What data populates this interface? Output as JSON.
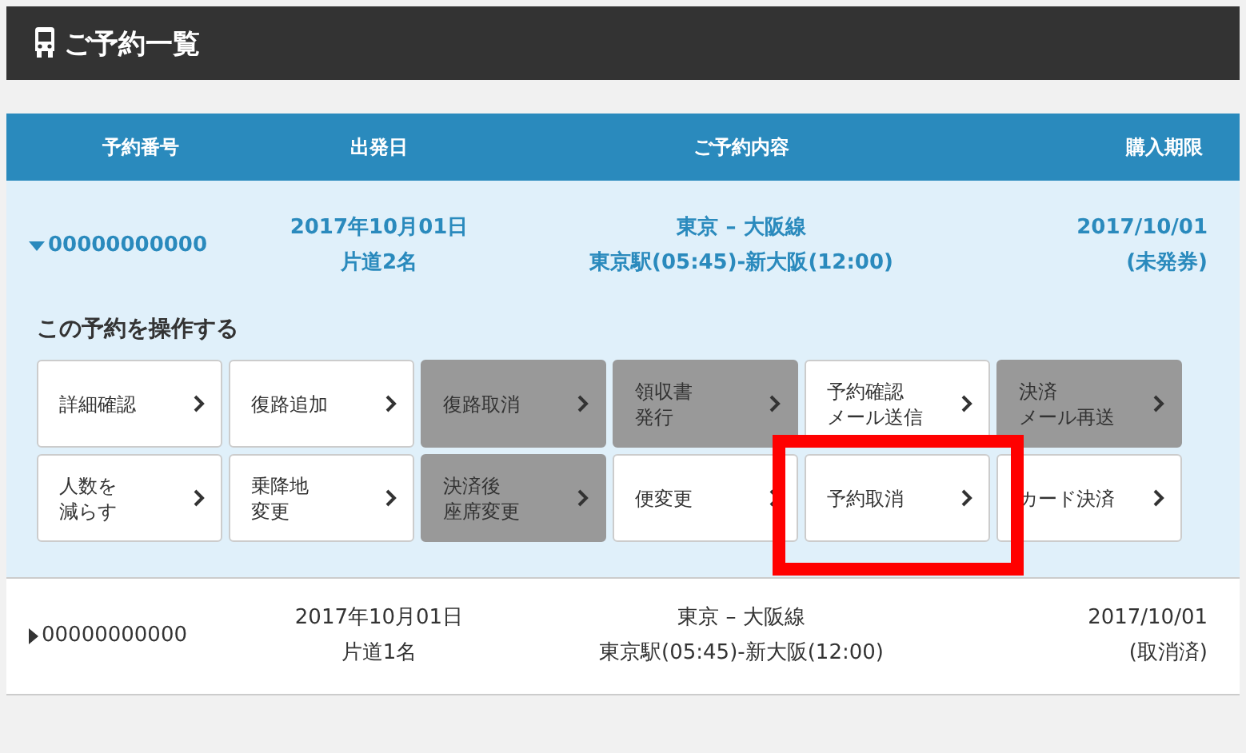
{
  "header": {
    "title": "ご予約一覧"
  },
  "table": {
    "columns": [
      "予約番号",
      "出発日",
      "ご予約内容",
      "購入期限"
    ],
    "rows": [
      {
        "expanded": true,
        "number": "00000000000",
        "date": "2017年10月01日",
        "passengers": "片道2名",
        "route": "東京 – 大阪線",
        "times": "東京駅(05:45)-新大阪(12:00)",
        "deadline": "2017/10/01",
        "status": "(未発券)",
        "panel": {
          "title": "この予約を操作する",
          "actions": [
            {
              "lines": [
                "詳細確認"
              ],
              "disabled": false
            },
            {
              "lines": [
                "復路追加"
              ],
              "disabled": false
            },
            {
              "lines": [
                "復路取消"
              ],
              "disabled": true
            },
            {
              "lines": [
                "領収書",
                "発行"
              ],
              "disabled": true
            },
            {
              "lines": [
                "予約確認",
                "メール送信"
              ],
              "disabled": false
            },
            {
              "lines": [
                "決済",
                "メール再送"
              ],
              "disabled": true
            },
            {
              "lines": [
                "人数を",
                "減らす"
              ],
              "disabled": false
            },
            {
              "lines": [
                "乗降地",
                "変更"
              ],
              "disabled": false
            },
            {
              "lines": [
                "決済後",
                "座席変更"
              ],
              "disabled": true
            },
            {
              "lines": [
                "便変更"
              ],
              "disabled": false
            },
            {
              "lines": [
                "予約取消"
              ],
              "disabled": false
            },
            {
              "lines": [
                "カード決済"
              ],
              "disabled": false
            }
          ]
        }
      },
      {
        "expanded": false,
        "number": "00000000000",
        "date": "2017年10月01日",
        "passengers": "片道1名",
        "route": "東京 – 大阪線",
        "times": "東京駅(05:45)-新大阪(12:00)",
        "deadline": "2017/10/01",
        "status": "(取消済)"
      }
    ]
  },
  "annotation": {
    "kind": "highlight"
  }
}
